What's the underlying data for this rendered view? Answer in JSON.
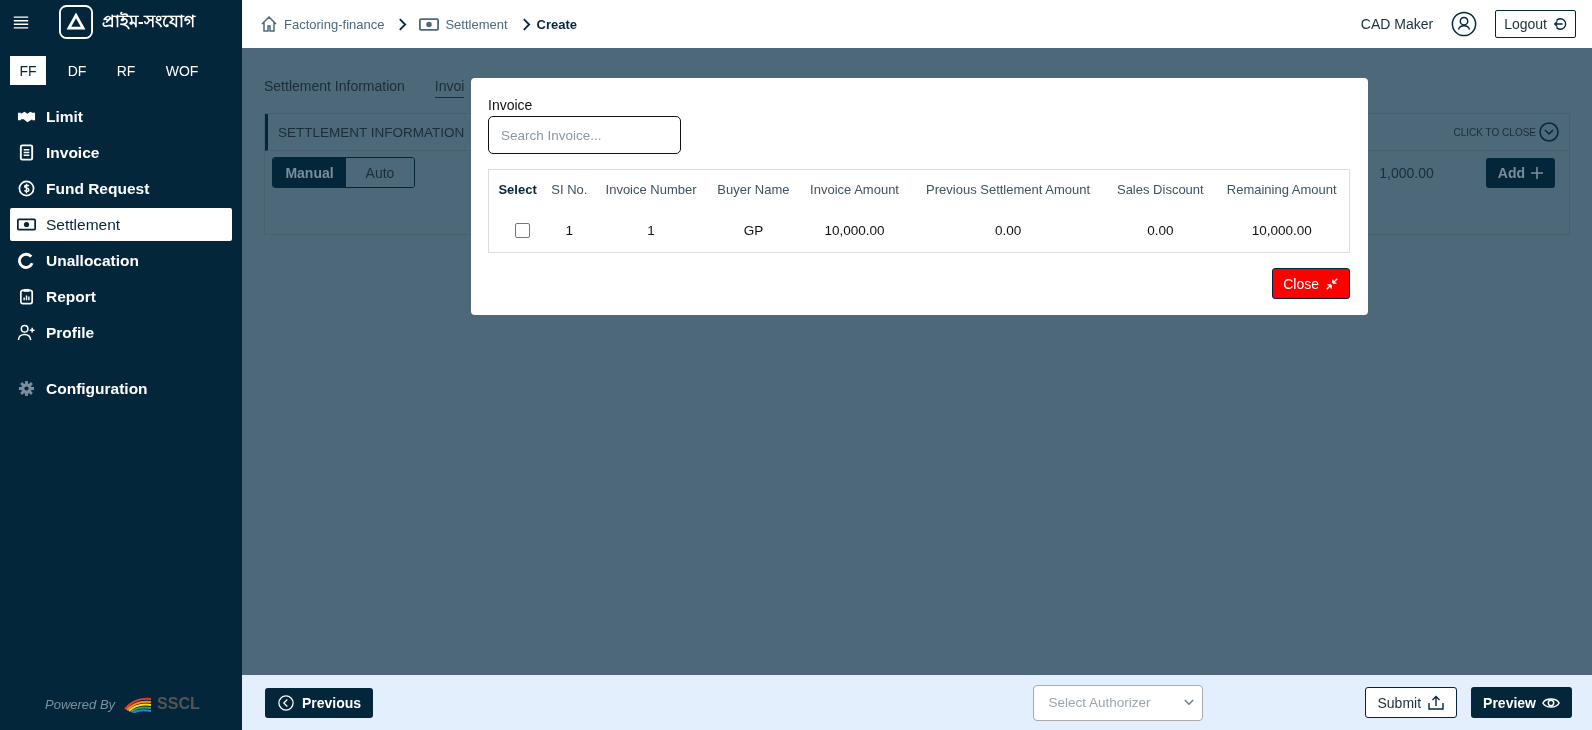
{
  "sidebar": {
    "logo_text": "প্রাইম-সংযোগ",
    "modules": [
      {
        "label": "FF",
        "selected": true
      },
      {
        "label": "DF",
        "selected": false
      },
      {
        "label": "RF",
        "selected": false
      },
      {
        "label": "WOF",
        "selected": false
      }
    ],
    "items": [
      {
        "label": "Limit",
        "selected": false
      },
      {
        "label": "Invoice",
        "selected": false
      },
      {
        "label": "Fund Request",
        "selected": false
      },
      {
        "label": "Settlement",
        "selected": true
      },
      {
        "label": "Unallocation",
        "selected": false
      },
      {
        "label": "Report",
        "selected": false
      },
      {
        "label": "Profile",
        "selected": false
      }
    ],
    "config_item": {
      "label": "Configuration"
    },
    "powered_by": "Powered By",
    "brand": "SSCL"
  },
  "breadcrumb": [
    {
      "label": "Factoring-finance",
      "current": false
    },
    {
      "label": "Settlement",
      "current": false
    },
    {
      "label": "Create",
      "current": true
    }
  ],
  "user": {
    "name": "CAD Maker"
  },
  "logout_button": "Logout",
  "page_tabs": [
    {
      "label": "Settlement Information",
      "selected": false
    },
    {
      "label": "Invoi",
      "selected": true
    }
  ],
  "section": {
    "title": "SETTLEMENT INFORMATION",
    "collapse_label": "CLICK TO CLOSE",
    "mode_toggle": [
      {
        "label": "Manual",
        "selected": true
      },
      {
        "label": "Auto",
        "selected": false
      }
    ],
    "amount": "1,000.00",
    "add_button": "Add"
  },
  "modal": {
    "field_label": "Invoice",
    "search": {
      "placeholder": "Search Invoice..."
    },
    "table": {
      "select_column": "Select",
      "columns": [
        "SI No.",
        "Invoice Number",
        "Buyer Name",
        "Invoice Amount",
        "Previous Settlement Amount",
        "Sales Discount",
        "Remaining Amount"
      ],
      "rows": [
        {
          "checked": false,
          "cells": [
            "1",
            "1",
            "GP",
            "10,000.00",
            "0.00",
            "0.00",
            "10,000.00"
          ]
        }
      ]
    },
    "close_button": "Close"
  },
  "footer": {
    "previous_button": "Previous",
    "authorizer": {
      "placeholder": "Select Authorizer"
    },
    "submit_button": "Submit",
    "preview_button": "Preview"
  }
}
